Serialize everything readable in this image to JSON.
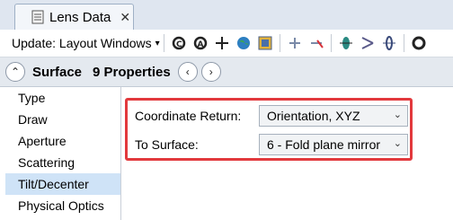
{
  "tab": {
    "title": "Lens Data",
    "close_glyph": "✕",
    "icon": "lens-data-icon"
  },
  "toolbar": {
    "update_label": "Update: Layout Windows",
    "update_caret": "▾",
    "tools": [
      "refresh-icon",
      "refresh-all-icon",
      "move-icon",
      "globe-icon",
      "image-icon",
      "add-element-icon",
      "remove-element-icon",
      "lens-icon",
      "ray-icon",
      "tilt-icon",
      "circle-icon"
    ]
  },
  "propbar": {
    "collapse_glyph": "⌃",
    "title": "Surface",
    "count": "9 Properties",
    "prev_glyph": "‹",
    "next_glyph": "›"
  },
  "nav": {
    "items": [
      "Type",
      "Draw",
      "Aperture",
      "Scattering",
      "Tilt/Decenter",
      "Physical Optics"
    ],
    "selected": "Tilt/Decenter"
  },
  "form": {
    "coordinate_return_label": "Coordinate Return:",
    "coordinate_return_value": "Orientation, XYZ",
    "to_surface_label": "To Surface:",
    "to_surface_value": "6 - Fold plane mirror",
    "caret": "⌄"
  },
  "colors": {
    "highlight": "#e2393d",
    "selected": "#cfe3f7"
  }
}
